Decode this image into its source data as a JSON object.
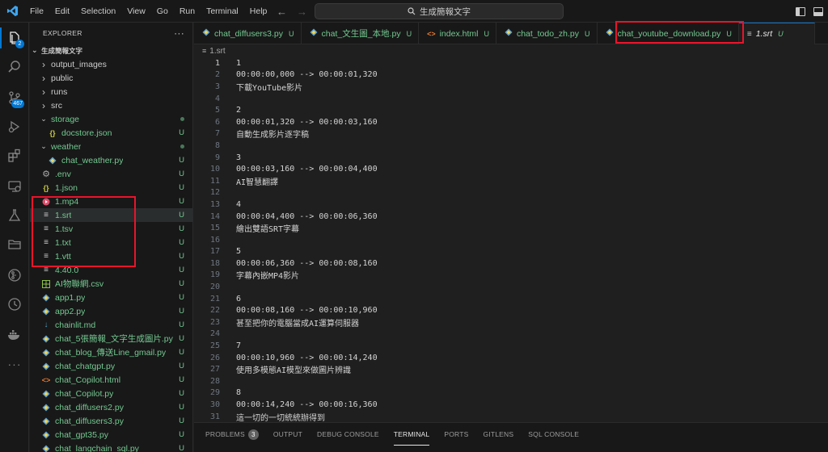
{
  "window": {
    "menu": [
      "File",
      "Edit",
      "Selection",
      "View",
      "Go",
      "Run",
      "Terminal",
      "Help"
    ],
    "search_text": "生成簡報文字"
  },
  "activity_bar": {
    "explorer_badge": "2",
    "scm_badge": "467"
  },
  "sidebar": {
    "title": "EXPLORER",
    "more": "···",
    "root_folder": "生成簡報文字",
    "items": [
      {
        "label": "output_images",
        "type": "folder",
        "expanded": false,
        "depth": 1,
        "color": "norm",
        "status": ""
      },
      {
        "label": "public",
        "type": "folder",
        "expanded": false,
        "depth": 1,
        "color": "norm",
        "status": ""
      },
      {
        "label": "runs",
        "type": "folder",
        "expanded": false,
        "depth": 1,
        "color": "norm",
        "status": ""
      },
      {
        "label": "src",
        "type": "folder",
        "expanded": false,
        "depth": 1,
        "color": "norm",
        "status": ""
      },
      {
        "label": "storage",
        "type": "folder",
        "expanded": true,
        "depth": 1,
        "color": "green",
        "status": "dot"
      },
      {
        "label": "docstore.json",
        "type": "json",
        "depth": 2,
        "color": "green",
        "status": "U"
      },
      {
        "label": "weather",
        "type": "folder",
        "expanded": true,
        "depth": 1,
        "color": "green",
        "status": "dot"
      },
      {
        "label": "chat_weather.py",
        "type": "python",
        "depth": 2,
        "color": "green",
        "status": "U"
      },
      {
        "label": ".env",
        "type": "gear",
        "depth": 1,
        "color": "green",
        "status": "U"
      },
      {
        "label": "1.json",
        "type": "json",
        "depth": 1,
        "color": "green",
        "status": "U"
      },
      {
        "label": "1.mp4",
        "type": "video",
        "depth": 1,
        "color": "green",
        "status": "U"
      },
      {
        "label": "1.srt",
        "type": "text",
        "depth": 1,
        "color": "green",
        "status": "U",
        "selected": true
      },
      {
        "label": "1.tsv",
        "type": "text",
        "depth": 1,
        "color": "green",
        "status": "U"
      },
      {
        "label": "1.txt",
        "type": "text",
        "depth": 1,
        "color": "green",
        "status": "U"
      },
      {
        "label": "1.vtt",
        "type": "text",
        "depth": 1,
        "color": "green",
        "status": "U"
      },
      {
        "label": "4.40.0",
        "type": "text",
        "depth": 1,
        "color": "green",
        "status": "U"
      },
      {
        "label": "AI物聯網.csv",
        "type": "csv",
        "depth": 1,
        "color": "green",
        "status": "U"
      },
      {
        "label": "app1.py",
        "type": "python",
        "depth": 1,
        "color": "green",
        "status": "U"
      },
      {
        "label": "app2.py",
        "type": "python",
        "depth": 1,
        "color": "green",
        "status": "U"
      },
      {
        "label": "chainlit.md",
        "type": "markdown",
        "depth": 1,
        "color": "green",
        "status": "U"
      },
      {
        "label": "chat_5張簡報_文字生成圖片.py",
        "type": "python",
        "depth": 1,
        "color": "green",
        "status": "U"
      },
      {
        "label": "chat_blog_傳送Line_gmail.py",
        "type": "python",
        "depth": 1,
        "color": "green",
        "status": "U"
      },
      {
        "label": "chat_chatgpt.py",
        "type": "python",
        "depth": 1,
        "color": "green",
        "status": "U"
      },
      {
        "label": "chat_Copilot.html",
        "type": "html",
        "depth": 1,
        "color": "green",
        "status": "U"
      },
      {
        "label": "chat_Copilot.py",
        "type": "python",
        "depth": 1,
        "color": "green",
        "status": "U"
      },
      {
        "label": "chat_diffusers2.py",
        "type": "python",
        "depth": 1,
        "color": "green",
        "status": "U"
      },
      {
        "label": "chat_diffusers3.py",
        "type": "python",
        "depth": 1,
        "color": "green",
        "status": "U"
      },
      {
        "label": "chat_gpt35.py",
        "type": "python",
        "depth": 1,
        "color": "green",
        "status": "U"
      },
      {
        "label": "chat_langchain_sql.py",
        "type": "python",
        "depth": 1,
        "color": "green",
        "status": "U"
      }
    ]
  },
  "tabs": [
    {
      "label": "chat_diffusers3.py",
      "type": "python",
      "status": "U",
      "active": false
    },
    {
      "label": "chat_文生圖_本地.py",
      "type": "python",
      "status": "U",
      "active": false
    },
    {
      "label": "index.html",
      "type": "html",
      "status": "U",
      "active": false
    },
    {
      "label": "chat_todo_zh.py",
      "type": "python",
      "status": "U",
      "active": false
    },
    {
      "label": "chat_youtube_download.py",
      "type": "python",
      "status": "U",
      "active": false
    },
    {
      "label": "1.srt",
      "type": "text",
      "status": "U",
      "active": true
    }
  ],
  "breadcrumb": {
    "file": "1.srt"
  },
  "editor": {
    "lines": [
      "1",
      "00:00:00,000 --> 00:00:01,320",
      "下載YouTube影片",
      "",
      "2",
      "00:00:01,320 --> 00:00:03,160",
      "自動生成影片逐字稿",
      "",
      "3",
      "00:00:03,160 --> 00:00:04,400",
      "AI智慧翻譯",
      "",
      "4",
      "00:00:04,400 --> 00:00:06,360",
      "繪出雙語SRT字幕",
      "",
      "5",
      "00:00:06,360 --> 00:00:08,160",
      "字幕內嵌MP4影片",
      "",
      "6",
      "00:00:08,160 --> 00:00:10,960",
      "甚至把你的電腦當成AI運算伺服器",
      "",
      "7",
      "00:00:10,960 --> 00:00:14,240",
      "使用多模態AI模型來做圖片辨識",
      "",
      "8",
      "00:00:14,240 --> 00:00:16,360",
      "這一切的一切統統辦得到"
    ]
  },
  "panel": {
    "tabs": [
      {
        "label": "PROBLEMS",
        "count": "3",
        "active": false
      },
      {
        "label": "OUTPUT",
        "active": false
      },
      {
        "label": "DEBUG CONSOLE",
        "active": false
      },
      {
        "label": "TERMINAL",
        "active": true
      },
      {
        "label": "PORTS",
        "active": false
      },
      {
        "label": "GITLENS",
        "active": false
      },
      {
        "label": "SQL CONSOLE",
        "active": false
      }
    ]
  },
  "colors": {
    "accent": "#0078d4",
    "git_untracked": "#73c991",
    "highlight": "#e8142c"
  }
}
